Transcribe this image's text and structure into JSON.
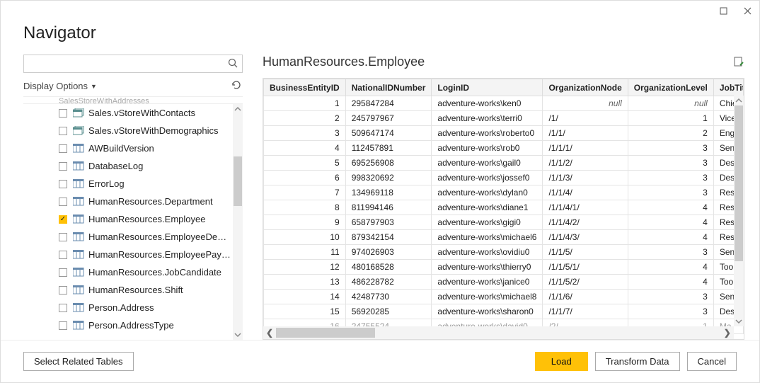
{
  "window": {
    "title": "Navigator"
  },
  "search": {
    "placeholder": ""
  },
  "display_options": {
    "label": "Display Options"
  },
  "tree_header_fragment": "SalesStoreWithAddresses",
  "tree": [
    {
      "label": "Sales.vStoreWithContacts",
      "type": "view",
      "checked": false
    },
    {
      "label": "Sales.vStoreWithDemographics",
      "type": "view",
      "checked": false
    },
    {
      "label": "AWBuildVersion",
      "type": "table",
      "checked": false
    },
    {
      "label": "DatabaseLog",
      "type": "table",
      "checked": false
    },
    {
      "label": "ErrorLog",
      "type": "table",
      "checked": false
    },
    {
      "label": "HumanResources.Department",
      "type": "table",
      "checked": false
    },
    {
      "label": "HumanResources.Employee",
      "type": "table",
      "checked": true
    },
    {
      "label": "HumanResources.EmployeeDepartmen...",
      "type": "table",
      "checked": false
    },
    {
      "label": "HumanResources.EmployeePayHistory",
      "type": "table",
      "checked": false
    },
    {
      "label": "HumanResources.JobCandidate",
      "type": "table",
      "checked": false
    },
    {
      "label": "HumanResources.Shift",
      "type": "table",
      "checked": false
    },
    {
      "label": "Person.Address",
      "type": "table",
      "checked": false
    },
    {
      "label": "Person.AddressType",
      "type": "table",
      "checked": false
    }
  ],
  "preview": {
    "title": "HumanResources.Employee",
    "columns": [
      "BusinessEntityID",
      "NationalIDNumber",
      "LoginID",
      "OrganizationNode",
      "OrganizationLevel",
      "JobTitle"
    ],
    "rows": [
      {
        "BusinessEntityID": "1",
        "NationalIDNumber": "295847284",
        "LoginID": "adventure-works\\ken0",
        "OrganizationNode": "null",
        "OrganizationLevel": "null",
        "JobTitle": "Chie"
      },
      {
        "BusinessEntityID": "2",
        "NationalIDNumber": "245797967",
        "LoginID": "adventure-works\\terri0",
        "OrganizationNode": "/1/",
        "OrganizationLevel": "1",
        "JobTitle": "Vice"
      },
      {
        "BusinessEntityID": "3",
        "NationalIDNumber": "509647174",
        "LoginID": "adventure-works\\roberto0",
        "OrganizationNode": "/1/1/",
        "OrganizationLevel": "2",
        "JobTitle": "Eng"
      },
      {
        "BusinessEntityID": "4",
        "NationalIDNumber": "112457891",
        "LoginID": "adventure-works\\rob0",
        "OrganizationNode": "/1/1/1/",
        "OrganizationLevel": "3",
        "JobTitle": "Sen"
      },
      {
        "BusinessEntityID": "5",
        "NationalIDNumber": "695256908",
        "LoginID": "adventure-works\\gail0",
        "OrganizationNode": "/1/1/2/",
        "OrganizationLevel": "3",
        "JobTitle": "Des"
      },
      {
        "BusinessEntityID": "6",
        "NationalIDNumber": "998320692",
        "LoginID": "adventure-works\\jossef0",
        "OrganizationNode": "/1/1/3/",
        "OrganizationLevel": "3",
        "JobTitle": "Des"
      },
      {
        "BusinessEntityID": "7",
        "NationalIDNumber": "134969118",
        "LoginID": "adventure-works\\dylan0",
        "OrganizationNode": "/1/1/4/",
        "OrganizationLevel": "3",
        "JobTitle": "Res"
      },
      {
        "BusinessEntityID": "8",
        "NationalIDNumber": "811994146",
        "LoginID": "adventure-works\\diane1",
        "OrganizationNode": "/1/1/4/1/",
        "OrganizationLevel": "4",
        "JobTitle": "Res"
      },
      {
        "BusinessEntityID": "9",
        "NationalIDNumber": "658797903",
        "LoginID": "adventure-works\\gigi0",
        "OrganizationNode": "/1/1/4/2/",
        "OrganizationLevel": "4",
        "JobTitle": "Res"
      },
      {
        "BusinessEntityID": "10",
        "NationalIDNumber": "879342154",
        "LoginID": "adventure-works\\michael6",
        "OrganizationNode": "/1/1/4/3/",
        "OrganizationLevel": "4",
        "JobTitle": "Res"
      },
      {
        "BusinessEntityID": "11",
        "NationalIDNumber": "974026903",
        "LoginID": "adventure-works\\ovidiu0",
        "OrganizationNode": "/1/1/5/",
        "OrganizationLevel": "3",
        "JobTitle": "Sen"
      },
      {
        "BusinessEntityID": "12",
        "NationalIDNumber": "480168528",
        "LoginID": "adventure-works\\thierry0",
        "OrganizationNode": "/1/1/5/1/",
        "OrganizationLevel": "4",
        "JobTitle": "Too"
      },
      {
        "BusinessEntityID": "13",
        "NationalIDNumber": "486228782",
        "LoginID": "adventure-works\\janice0",
        "OrganizationNode": "/1/1/5/2/",
        "OrganizationLevel": "4",
        "JobTitle": "Too"
      },
      {
        "BusinessEntityID": "14",
        "NationalIDNumber": "42487730",
        "LoginID": "adventure-works\\michael8",
        "OrganizationNode": "/1/1/6/",
        "OrganizationLevel": "3",
        "JobTitle": "Sen"
      },
      {
        "BusinessEntityID": "15",
        "NationalIDNumber": "56920285",
        "LoginID": "adventure-works\\sharon0",
        "OrganizationNode": "/1/1/7/",
        "OrganizationLevel": "3",
        "JobTitle": "Des"
      },
      {
        "BusinessEntityID": "16",
        "NationalIDNumber": "24755524",
        "LoginID": "adventure-works\\david0",
        "OrganizationNode": "/2/",
        "OrganizationLevel": "1",
        "JobTitle": "Ma"
      }
    ]
  },
  "footer": {
    "select_related": "Select Related Tables",
    "load": "Load",
    "transform": "Transform Data",
    "cancel": "Cancel"
  }
}
